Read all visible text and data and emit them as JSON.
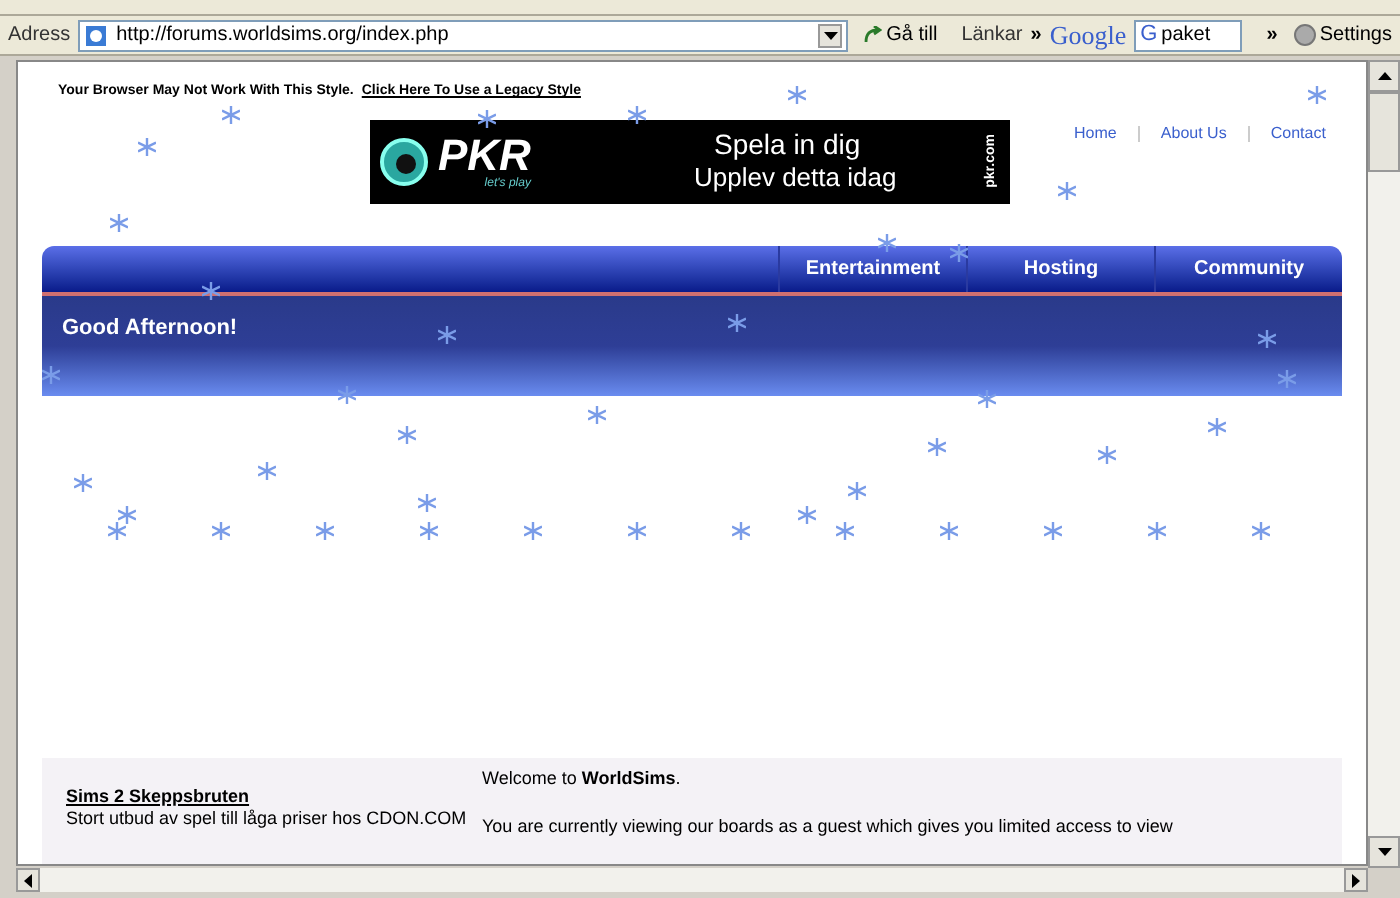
{
  "address_bar": {
    "label": "Adress",
    "url": "http://forums.worldsims.org/index.php",
    "go": "Gå till",
    "links": "Länkar",
    "links_chevron": "»",
    "google_logo": "Google",
    "search_engine_glyph": "G",
    "search_value": "paket",
    "search_chevron": "»",
    "settings": "Settings"
  },
  "page": {
    "browser_notice": "Your Browser May Not Work With This Style.",
    "legacy_link": "Click Here To Use a Legacy Style",
    "ad": {
      "brand": "PKR",
      "tagline": "let's play",
      "headline": "Spela in dig",
      "subline": "Upplev detta idag",
      "domain": "pkr.com"
    },
    "top_links": [
      "Home",
      "About Us",
      "Contact"
    ],
    "nav_tabs": [
      "Entertainment",
      "Hosting",
      "Community"
    ],
    "greeting": "Good Afternoon!",
    "sidebar_link": "Sims 2 Skeppsbruten",
    "sidebar_text": "Stort utbud av spel till låga priser hos CDON.COM",
    "welcome": "Welcome to **WorldSims**.",
    "intro": "You are currently viewing our boards as a guest which gives you limited access to view"
  }
}
